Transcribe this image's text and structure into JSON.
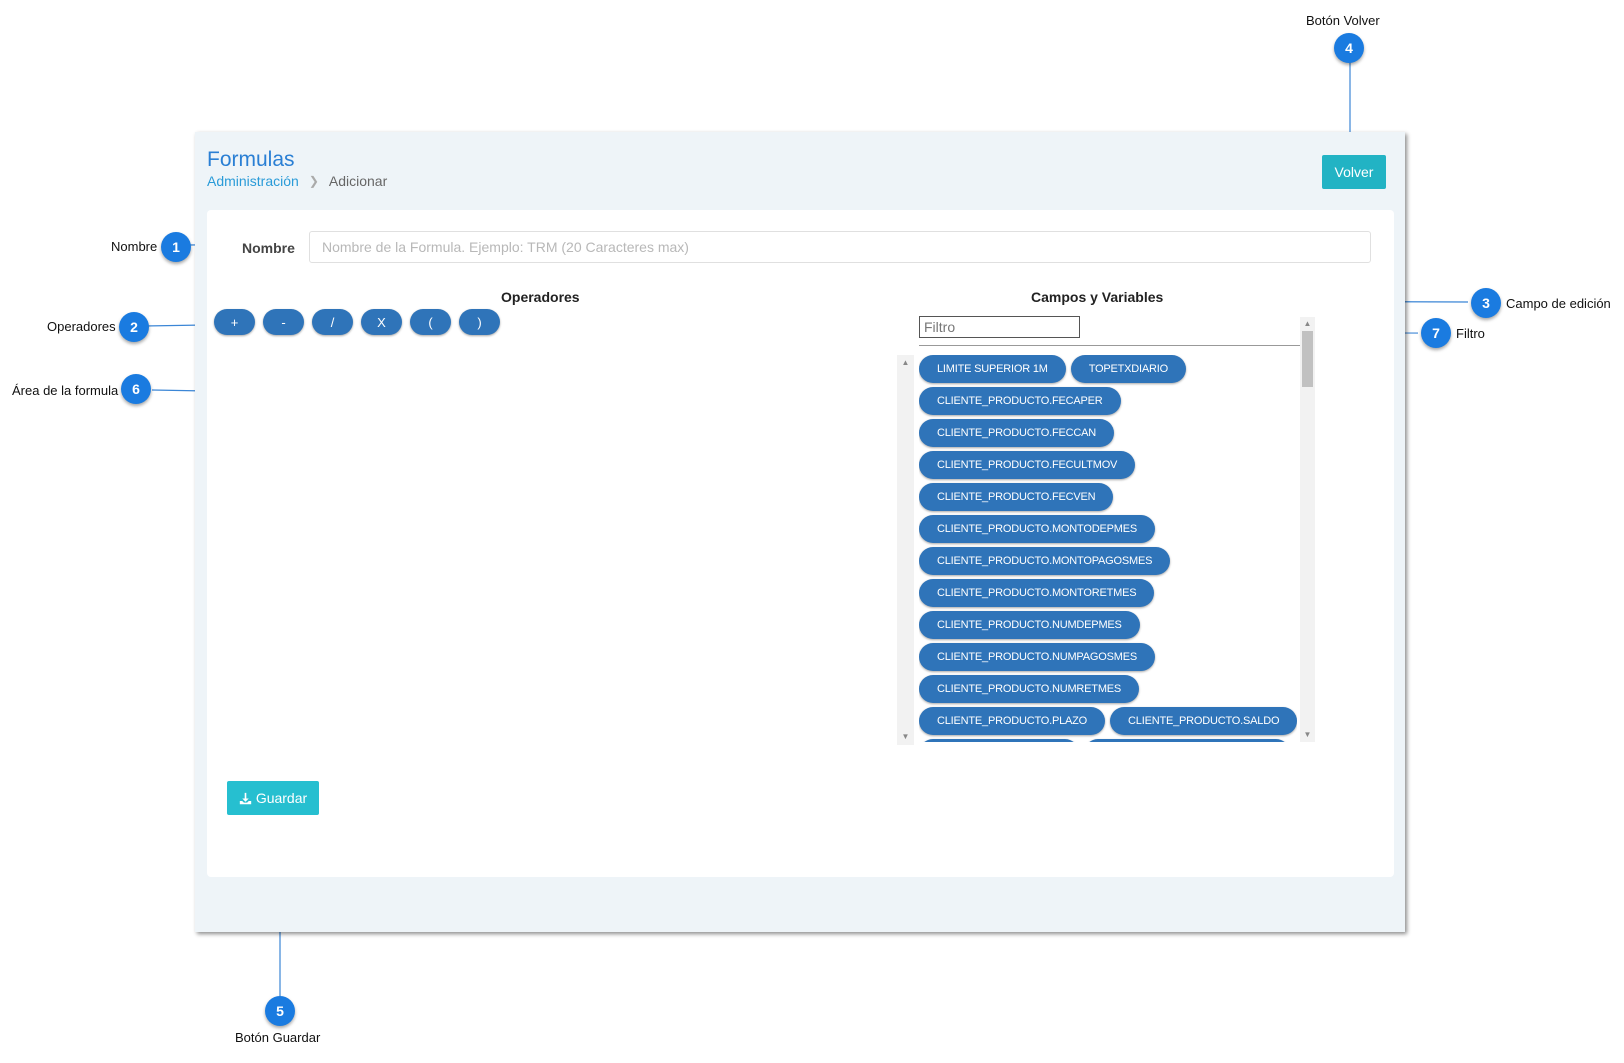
{
  "header": {
    "title": "Formulas",
    "breadcrumb": {
      "parent": "Administración",
      "current": "Adicionar"
    },
    "back_button": "Volver"
  },
  "form": {
    "name_label": "Nombre",
    "name_placeholder": "Nombre de la Formula. Ejemplo: TRM (20 Caracteres max)",
    "operators_title": "Operadores",
    "operators": [
      "+",
      "-",
      "/",
      "X",
      "(",
      ")"
    ],
    "fields_title": "Campos y Variables",
    "filter_placeholder": "Filtro",
    "variables": [
      [
        "LIMITE SUPERIOR 1M",
        "TOPETXDIARIO"
      ],
      [
        "CLIENTE_PRODUCTO.FECAPER"
      ],
      [
        "CLIENTE_PRODUCTO.FECCAN"
      ],
      [
        "CLIENTE_PRODUCTO.FECULTMOV"
      ],
      [
        "CLIENTE_PRODUCTO.FECVEN"
      ],
      [
        "CLIENTE_PRODUCTO.MONTODEPMES"
      ],
      [
        "CLIENTE_PRODUCTO.MONTOPAGOSMES"
      ],
      [
        "CLIENTE_PRODUCTO.MONTORETMES"
      ],
      [
        "CLIENTE_PRODUCTO.NUMDEPMES"
      ],
      [
        "CLIENTE_PRODUCTO.NUMPAGOSMES"
      ],
      [
        "CLIENTE_PRODUCTO.NUMRETMES"
      ],
      [
        "CLIENTE_PRODUCTO.PLAZO",
        "CLIENTE_PRODUCTO.SALDO"
      ]
    ],
    "save_button": "Guardar"
  },
  "annotations": {
    "c1": {
      "number": "1",
      "label": "Nombre"
    },
    "c2": {
      "number": "2",
      "label": "Operadores"
    },
    "c3": {
      "number": "3",
      "label": "Campo de edición"
    },
    "c4": {
      "number": "4",
      "label": "Botón Volver"
    },
    "c5": {
      "number": "5",
      "label": "Botón  Guardar"
    },
    "c6": {
      "number": "6",
      "label": "Área de la formula"
    },
    "c7": {
      "number": "7",
      "label": "Filtro"
    }
  },
  "colors": {
    "accent": "#2a7fd4",
    "pill": "#2f74b9",
    "teal_button": "#22b3c4",
    "callout": "#1a7be0"
  }
}
